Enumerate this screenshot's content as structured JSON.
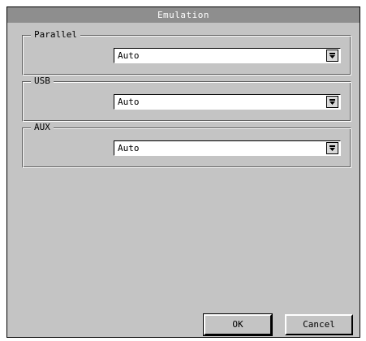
{
  "window": {
    "title": "Emulation"
  },
  "groups": [
    {
      "label": "Parallel",
      "value": "Auto"
    },
    {
      "label": "USB",
      "value": "Auto"
    },
    {
      "label": "AUX",
      "value": "Auto"
    }
  ],
  "buttons": {
    "ok": "OK",
    "cancel": "Cancel"
  },
  "icons": {
    "dropdown": "chevron-down-icon"
  },
  "colors": {
    "titlebar": "#8e8e8e",
    "background": "#c4c4c4"
  }
}
